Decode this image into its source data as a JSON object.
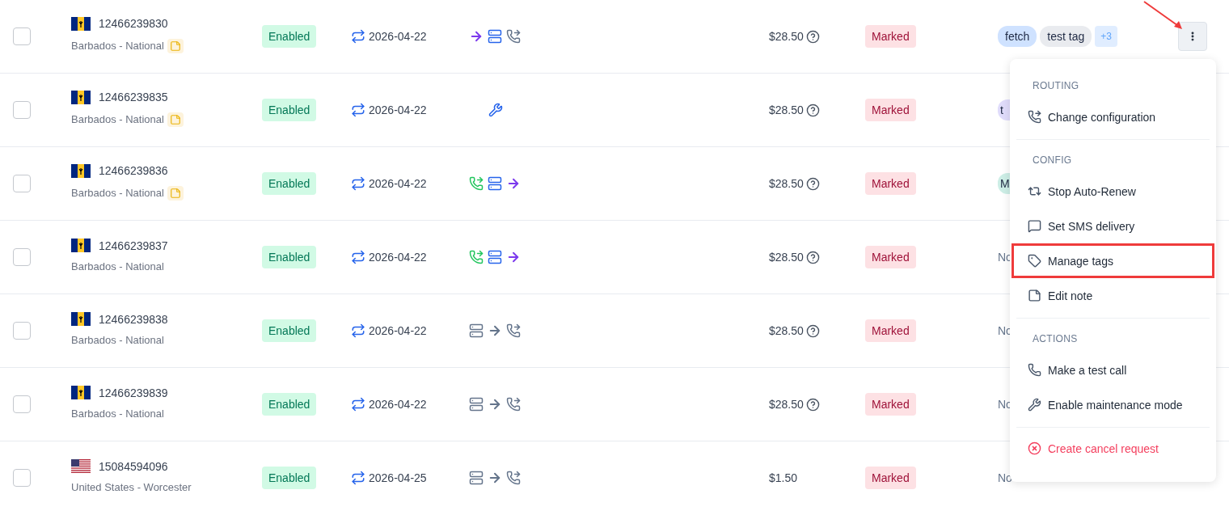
{
  "rows": [
    {
      "checked": false,
      "flag": {
        "kind": "bb"
      },
      "number": "12466239830",
      "location": "Barbados - National",
      "note": true,
      "status": "Enabled",
      "renew_date": "2026-04-22",
      "routing": [
        {
          "kind": "forward",
          "color": "#7c3aed"
        },
        {
          "kind": "server",
          "color": "#2563eb"
        },
        {
          "kind": "call-forward",
          "color": "#64748b"
        }
      ],
      "price": "$28.50",
      "price_help": true,
      "mark": "Marked",
      "tags": [
        {
          "kind": "chip",
          "label": "fetch",
          "color": "#cfe2ff"
        },
        {
          "kind": "chip",
          "label": "test tag",
          "color": "#e9ebef"
        },
        {
          "kind": "more",
          "label": "+3",
          "color": "#e0edff"
        }
      ],
      "menu_open": true
    },
    {
      "checked": false,
      "flag": {
        "kind": "bb"
      },
      "number": "12466239835",
      "location": "Barbados - National",
      "note": true,
      "status": "Enabled",
      "renew_date": "2026-04-22",
      "routing": [
        {
          "kind": "maintenance",
          "color": "#2563eb"
        }
      ],
      "price": "$28.50",
      "price_help": true,
      "mark": "Marked",
      "tags": [
        {
          "kind": "chip",
          "label": "t",
          "color": "#e0dcfb"
        }
      ],
      "menu_open": false
    },
    {
      "checked": false,
      "flag": {
        "kind": "bb"
      },
      "number": "12466239836",
      "location": "Barbados - National",
      "note": true,
      "status": "Enabled",
      "renew_date": "2026-04-22",
      "routing": [
        {
          "kind": "call-forward",
          "color": "#22c55e"
        },
        {
          "kind": "server",
          "color": "#2563eb"
        },
        {
          "kind": "forward",
          "color": "#7c3aed"
        }
      ],
      "price": "$28.50",
      "price_help": true,
      "mark": "Marked",
      "tags": [
        {
          "kind": "chip",
          "label": "M",
          "color": "#cdeee6"
        }
      ],
      "menu_open": false
    },
    {
      "checked": false,
      "flag": {
        "kind": "bb"
      },
      "number": "12466239837",
      "location": "Barbados - National",
      "note": false,
      "status": "Enabled",
      "renew_date": "2026-04-22",
      "routing": [
        {
          "kind": "call-forward",
          "color": "#22c55e"
        },
        {
          "kind": "server",
          "color": "#2563eb"
        },
        {
          "kind": "forward",
          "color": "#7c3aed"
        }
      ],
      "price": "$28.50",
      "price_help": true,
      "mark": "Marked",
      "tags": [
        {
          "kind": "plain",
          "label": "No"
        }
      ],
      "menu_open": false
    },
    {
      "checked": false,
      "flag": {
        "kind": "bb"
      },
      "number": "12466239838",
      "location": "Barbados - National",
      "note": false,
      "status": "Enabled",
      "renew_date": "2026-04-22",
      "routing": [
        {
          "kind": "server",
          "color": "#64748b"
        },
        {
          "kind": "forward",
          "color": "#64748b"
        },
        {
          "kind": "call-forward",
          "color": "#64748b"
        }
      ],
      "price": "$28.50",
      "price_help": true,
      "mark": "Marked",
      "tags": [
        {
          "kind": "plain",
          "label": "No"
        }
      ],
      "menu_open": false
    },
    {
      "checked": false,
      "flag": {
        "kind": "bb"
      },
      "number": "12466239839",
      "location": "Barbados - National",
      "note": false,
      "status": "Enabled",
      "renew_date": "2026-04-22",
      "routing": [
        {
          "kind": "server",
          "color": "#64748b"
        },
        {
          "kind": "forward",
          "color": "#64748b"
        },
        {
          "kind": "call-forward",
          "color": "#64748b"
        }
      ],
      "price": "$28.50",
      "price_help": true,
      "mark": "Marked",
      "tags": [
        {
          "kind": "plain",
          "label": "No"
        }
      ],
      "menu_open": false
    },
    {
      "checked": false,
      "flag": {
        "kind": "us"
      },
      "number": "15084594096",
      "location": "United States - Worcester",
      "note": false,
      "status": "Enabled",
      "renew_date": "2026-04-25",
      "routing": [
        {
          "kind": "server",
          "color": "#64748b"
        },
        {
          "kind": "forward",
          "color": "#64748b"
        },
        {
          "kind": "call-forward",
          "color": "#64748b"
        }
      ],
      "price": "$1.50",
      "price_help": false,
      "mark": "Marked",
      "tags": [
        {
          "kind": "plain",
          "label": "No"
        }
      ],
      "menu_open": false
    }
  ],
  "menu": {
    "sections": [
      {
        "heading": "ROUTING",
        "items": [
          {
            "kind": "configure",
            "label": "Change configuration",
            "highlighted": false
          }
        ]
      },
      {
        "heading": "CONFIG",
        "items": [
          {
            "kind": "renew",
            "label": "Stop Auto-Renew",
            "highlighted": false
          },
          {
            "kind": "sms",
            "label": "Set SMS delivery",
            "highlighted": false
          },
          {
            "kind": "tags",
            "label": "Manage tags",
            "highlighted": true
          },
          {
            "kind": "note",
            "label": "Edit note",
            "highlighted": false
          }
        ]
      },
      {
        "heading": "ACTIONS",
        "items": [
          {
            "kind": "call",
            "label": "Make a test call",
            "highlighted": false
          },
          {
            "kind": "maintenance",
            "label": "Enable maintenance mode",
            "highlighted": false
          }
        ]
      },
      {
        "items": [
          {
            "kind": "cancel",
            "label": "Create cancel request",
            "highlighted": false
          }
        ]
      }
    ]
  },
  "annotation": {
    "arrow": true
  }
}
